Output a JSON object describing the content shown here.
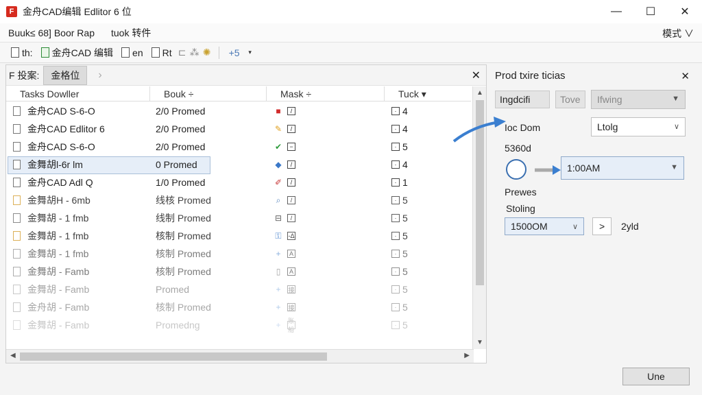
{
  "app": {
    "title": "金舟CAD编辑 Edlitor 6 位",
    "icon_letter": "F"
  },
  "window": {
    "minimize": "—",
    "maximize": "☐",
    "close": "✕"
  },
  "menu": {
    "left": "Buuk≤ 68] Boor Rap",
    "mid": "tuok 转件",
    "right": "模式 ∨"
  },
  "toolbar": {
    "btn1": "th:",
    "btn2": "金舟CAD 编辑",
    "btn3": "en",
    "btn4": "Rt",
    "btn5": "+5"
  },
  "left_pane": {
    "label": "F 投案:",
    "tab": "金格位",
    "close": "✕",
    "columns": [
      "Tasks Dowller",
      "Bouk ÷",
      "Mask ÷",
      "Tuck ▾"
    ],
    "rows": [
      {
        "name": "金舟CAD S-6-O",
        "book": "2/0 Promed",
        "mark_icon": "red",
        "mark_text": "/",
        "tuck": "4",
        "fade": "",
        "file": "white"
      },
      {
        "name": "金舟CAD Edlitor 6",
        "book": "2/0 Promed",
        "mark_icon": "multi",
        "mark_text": "/",
        "tuck": "4",
        "fade": "",
        "file": "white"
      },
      {
        "name": "金舟CAD S-6-O",
        "book": "2/0 Promed",
        "mark_icon": "green",
        "mark_text": "−",
        "tuck": "5",
        "fade": "",
        "file": "white"
      },
      {
        "name": "金舞胡l-6r lm",
        "book": "0 Promed",
        "mark_icon": "blue",
        "mark_text": "/",
        "tuck": "4",
        "fade": "",
        "file": "white",
        "selected": true
      },
      {
        "name": "金舟CAD Adl Q",
        "book": "1/0 Promed",
        "mark_icon": "pen",
        "mark_text": "/",
        "tuck": "1",
        "fade": "",
        "file": "white"
      },
      {
        "name": "金舞胡H - 6mb",
        "book": "线核 Promed",
        "mark_icon": "magnify",
        "mark_text": "/",
        "tuck": "5",
        "fade": "fade1",
        "file": "yellow"
      },
      {
        "name": "金舞胡 - 1 fmb",
        "book": "线制 Promed",
        "mark_icon": "doc",
        "mark_text": "/",
        "tuck": "5",
        "fade": "fade1",
        "file": "white"
      },
      {
        "name": "金舞胡 - 1 fmb",
        "book": "核制 Promed",
        "mark_icon": "lock",
        "mark_text": "-Δ",
        "tuck": "5",
        "fade": "fade1",
        "file": "yellow"
      },
      {
        "name": "金舞胡 - 1 fmb",
        "book": "核制 Promed",
        "mark_icon": "plus",
        "mark_text": "A",
        "tuck": "5",
        "fade": "fade2",
        "file": "white"
      },
      {
        "name": "金舞胡 - Famb",
        "book": "核制 Promed",
        "mark_icon": "page",
        "mark_text": "A",
        "tuck": "5",
        "fade": "fade2",
        "file": "white"
      },
      {
        "name": "金舞胡 - Famb",
        "book": "Promed",
        "mark_icon": "plus",
        "mark_text": "接",
        "tuck": "5",
        "fade": "fade3",
        "file": "white"
      },
      {
        "name": "金舟胡 - Famb",
        "book": "核制 Promed",
        "mark_icon": "plus",
        "mark_text": "接",
        "tuck": "5",
        "fade": "fade3",
        "file": "white"
      },
      {
        "name": "金舞胡 - Famb",
        "book": "Promedng",
        "mark_icon": "plus",
        "mark_text": "账船",
        "tuck": "5",
        "fade": "fade4",
        "file": "white"
      }
    ]
  },
  "right_pane": {
    "title": "Prod txire ticias",
    "close": "✕",
    "btn_a": "Ingdcifi",
    "btn_b": "Tove",
    "dropdown1": "Ifwing",
    "label_loc": "Ioc Dom",
    "dropdown2": "Ltolg",
    "section1": "5360d",
    "dropdown3": "1:00AM",
    "section2": "Prewes",
    "section3": "Stoling",
    "dropdown4": "1500OM",
    "next_btn": ">",
    "side_text": "2yld"
  },
  "footer": {
    "ok": "Une"
  }
}
